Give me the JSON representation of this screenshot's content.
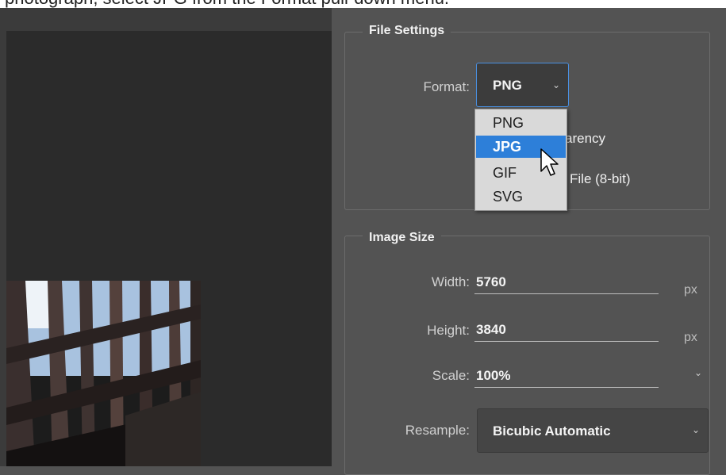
{
  "caption": "photograph, select JPG from the Format pull-down menu.",
  "file_settings": {
    "title": "File Settings",
    "format_label": "Format:",
    "format_value": "PNG",
    "partial_option_1": "arency",
    "partial_option_2": "File (8-bit)",
    "format_options": [
      "PNG",
      "JPG",
      "GIF",
      "SVG"
    ],
    "highlighted_option": "JPG"
  },
  "image_size": {
    "title": "Image Size",
    "width_label": "Width:",
    "width_value": "5760",
    "width_unit": "px",
    "height_label": "Height:",
    "height_value": "3840",
    "height_unit": "px",
    "scale_label": "Scale:",
    "scale_value": "100%",
    "resample_label": "Resample:",
    "resample_value": "Bicubic Automatic"
  },
  "icons": {
    "chevron": "chevron-down-icon",
    "cursor": "pointer-cursor-icon"
  }
}
